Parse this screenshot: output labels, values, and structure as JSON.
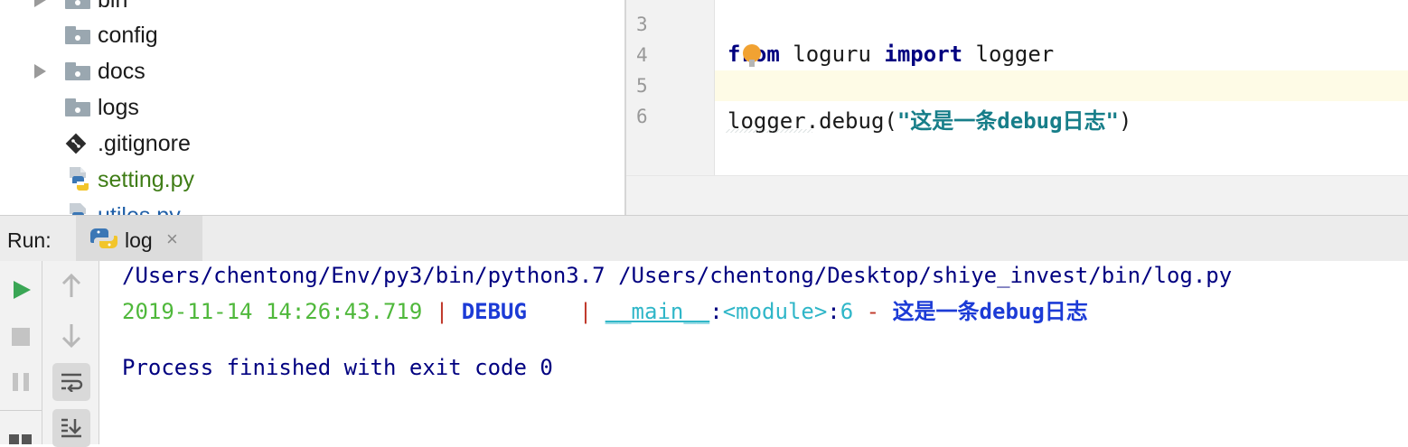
{
  "project_tree": {
    "items": [
      {
        "label": "bin",
        "kind": "folder",
        "expandable": true
      },
      {
        "label": "config",
        "kind": "folder",
        "expandable": false
      },
      {
        "label": "docs",
        "kind": "folder",
        "expandable": true
      },
      {
        "label": "logs",
        "kind": "folder",
        "expandable": false
      },
      {
        "label": ".gitignore",
        "kind": "git-file"
      },
      {
        "label": "setting.py",
        "kind": "python-file"
      },
      {
        "label": "utiles.py",
        "kind": "python-file"
      }
    ]
  },
  "editor": {
    "lines": [
      {
        "number": "3",
        "code": ""
      },
      {
        "number": "4",
        "kw1": "from",
        "mid": " loguru ",
        "kw2": "import",
        "tail": " logger"
      },
      {
        "number": "5",
        "code": ""
      },
      {
        "number": "6",
        "pre": "logger.debug(",
        "string": "\"这是一条debug日志\"",
        "post": ")"
      }
    ],
    "current_line": "5"
  },
  "run_panel": {
    "label": "Run:",
    "tab": {
      "label": "log",
      "close": "×"
    },
    "console": {
      "command": "/Users/chentong/Env/py3/bin/python3.7 /Users/chentong/Desktop/shiye_invest/bin/log.py",
      "log": {
        "timestamp": "2019-11-14 14:26:43.719",
        "sep1": " | ",
        "level": "DEBUG",
        "pad": "    ",
        "sep2": "| ",
        "module": "__main__",
        "colon1": ":",
        "func": "<module>",
        "colon2": ":",
        "line": "6",
        "dash": " - ",
        "message": "这是一条debug日志"
      },
      "exit": "Process finished with exit code 0"
    }
  },
  "colors": {
    "keyword": "#000080",
    "string": "#177e89",
    "timestamp": "#4fb83b",
    "level": "#1c3bd6",
    "module": "#2fb6c8",
    "run_green": "#3aa655"
  }
}
